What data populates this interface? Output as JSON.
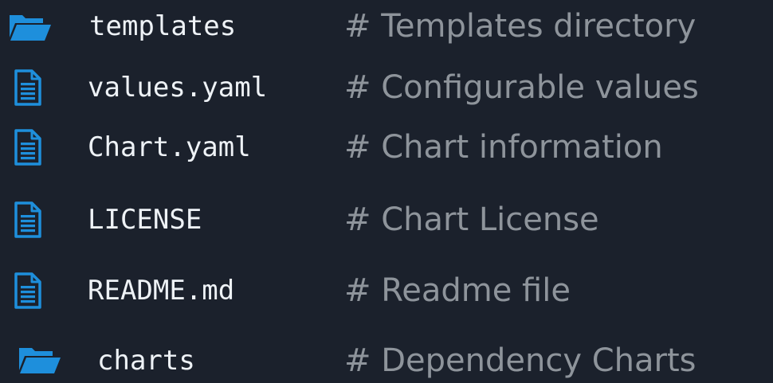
{
  "colors": {
    "background": "#1b212c",
    "icon_blue": "#1e8fdc",
    "filename": "#eef2f6",
    "comment": "#8e949b"
  },
  "entries": [
    {
      "icon": "folder-icon",
      "name": "templates",
      "comment": "# Templates directory"
    },
    {
      "icon": "file-icon",
      "name": "values.yaml",
      "comment": "# Configurable values"
    },
    {
      "icon": "file-icon",
      "name": "Chart.yaml",
      "comment": "# Chart information"
    },
    {
      "icon": "file-icon",
      "name": "LICENSE",
      "comment": "# Chart License"
    },
    {
      "icon": "file-icon",
      "name": "README.md",
      "comment": "# Readme file"
    },
    {
      "icon": "folder-icon",
      "name": "charts",
      "comment": "# Dependency Charts"
    }
  ]
}
